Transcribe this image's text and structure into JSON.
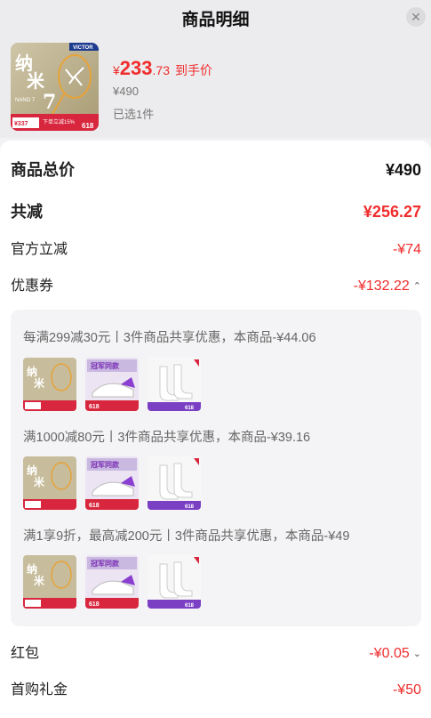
{
  "header": {
    "title": "商品明细",
    "close_icon": "close-icon"
  },
  "product": {
    "price_symbol": "¥",
    "price_int": "233",
    "price_dec": ".73",
    "price_tag": "到手价",
    "original_price": "¥490",
    "selected": "已选1件",
    "thumb_text": {
      "brand": "VICTOR",
      "big1": "纳",
      "big2": "米",
      "num": "7",
      "sub": "NANO 7",
      "promo": "下单立减15%",
      "badge": "618",
      "price": "¥337"
    }
  },
  "summary": {
    "total_label": "商品总价",
    "total_value": "¥490",
    "reduce_label": "共减",
    "reduce_value": "¥256.27",
    "official_label": "官方立减",
    "official_value": "-¥74",
    "coupon_label": "优惠券",
    "coupon_value": "-¥132.22",
    "redpacket_label": "红包",
    "redpacket_value": "-¥0.05",
    "firstbuy_label": "首购礼金",
    "firstbuy_value": "-¥50"
  },
  "coupons": [
    {
      "desc": "每满299减30元丨3件商品共享优惠，本商品-¥44.06"
    },
    {
      "desc": "满1000减80元丨3件商品共享优惠，本商品-¥39.16"
    },
    {
      "desc": "满1享9折，最高减200元丨3件商品共享优惠，本商品-¥49"
    }
  ],
  "thumb_labels": {
    "shoe_banner": "冠军同款",
    "shoe_badge": "618",
    "sock_badge": "618"
  },
  "colors": {
    "accent_red": "#f02c2c",
    "panel_bg": "#ffffff",
    "header_bg": "#ececee",
    "coupon_box_bg": "#f4f4f6"
  }
}
